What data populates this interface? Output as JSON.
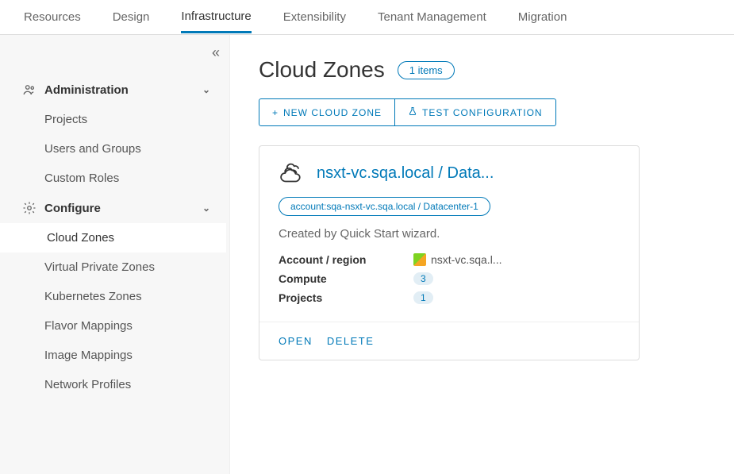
{
  "tabs": [
    "Resources",
    "Design",
    "Infrastructure",
    "Extensibility",
    "Tenant Management",
    "Migration"
  ],
  "activeTab": "Infrastructure",
  "sidebar": {
    "sections": [
      {
        "label": "Administration",
        "items": [
          "Projects",
          "Users and Groups",
          "Custom Roles"
        ]
      },
      {
        "label": "Configure",
        "items": [
          "Cloud Zones",
          "Virtual Private Zones",
          "Kubernetes Zones",
          "Flavor Mappings",
          "Image Mappings",
          "Network Profiles"
        ]
      }
    ],
    "activeItem": "Cloud Zones"
  },
  "page": {
    "title": "Cloud Zones",
    "itemsBadge": "1 items",
    "newBtn": "NEW CLOUD ZONE",
    "testBtn": "TEST CONFIGURATION"
  },
  "card": {
    "title": "nsxt-vc.sqa.local / Data...",
    "tag": "account:sqa-nsxt-vc.sqa.local / Datacenter-1",
    "desc": "Created by Quick Start wizard.",
    "props": {
      "accountLabel": "Account / region",
      "accountValue": "nsxt-vc.sqa.l...",
      "computeLabel": "Compute",
      "computeValue": "3",
      "projectsLabel": "Projects",
      "projectsValue": "1"
    },
    "openBtn": "OPEN",
    "deleteBtn": "DELETE"
  }
}
